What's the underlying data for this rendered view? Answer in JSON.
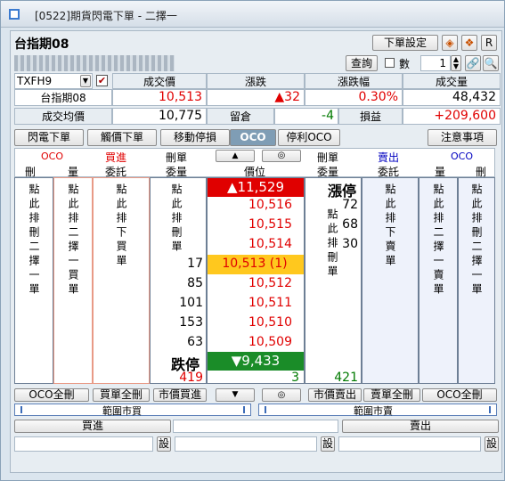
{
  "window": {
    "title": "[0522]期貨閃電下單 - 二擇一"
  },
  "header": {
    "name": "台指期08",
    "order_settings": "下單設定",
    "r_label": "R",
    "query": "查詢",
    "qty_label": "數",
    "qty_value": "1",
    "account_masked": "XXXXXXX XXXXXXXX"
  },
  "quote": {
    "symbol": "TXFH9",
    "labels": {
      "last": "成交價",
      "change": "漲跌",
      "pct": "漲跌幅",
      "volume": "成交量",
      "avg": "成交均價",
      "oi": "留倉",
      "pnl": "損益"
    },
    "product": "台指期08",
    "last": "10,513",
    "change": "▲32",
    "pct": "0.30%",
    "volume": "48,432",
    "avg": "10,775",
    "oi": "-4",
    "pnl": "+209,600"
  },
  "tabs": {
    "t1": "閃電下單",
    "t2": "觸價下單",
    "t3": "移動停損",
    "t4": "OCO",
    "t5": "停利OCO",
    "notes": "注意事項"
  },
  "columns": {
    "oco_l": "OCO",
    "buy": "買進",
    "mkt_l": "刪單",
    "up": "▲",
    "circle": "◎",
    "mkt_r": "刪單",
    "sell": "賣出",
    "oco_r": "OCO"
  },
  "subheads": {
    "s1": "刪",
    "s2": "量",
    "s3": "委託",
    "s4": "委量",
    "s5": "價位",
    "s6": "委量",
    "s7": "委託",
    "s8": "量",
    "s9": "刪"
  },
  "col_text": {
    "c1": "點此排刪二擇一單",
    "c2": "點此排二擇一買單",
    "c3": "點此排下買單",
    "c4": "點此排刪單",
    "c6": "點此排刪單",
    "c7": "點此排下賣單",
    "c8": "點此排二擇一賣單",
    "c9": "點此排刪二擇一單"
  },
  "ladder": {
    "limit_up": "漲停",
    "limit_up_price": "▲11,529",
    "prices": [
      "10,516",
      "10,515",
      "10,514",
      "10,513 (1)",
      "10,512",
      "10,511",
      "10,510",
      "10,509"
    ],
    "bid_vol": [
      "",
      "",
      "",
      "17",
      "85",
      "101",
      "153",
      "63"
    ],
    "ask_vol": [
      "72",
      "68",
      "30",
      "",
      "",
      "",
      "",
      ""
    ],
    "limit_down": "跌停",
    "limit_down_price": "▼9,433",
    "total_bid": "419",
    "mid_total": "3",
    "total_ask": "421"
  },
  "bottom": {
    "oco_all_l": "OCO全刪",
    "buy_all": "買單全刪",
    "mkt_buy": "市價買進",
    "down": "▼",
    "circle": "◎",
    "mkt_sell": "市價賣出",
    "sell_all": "賣單全刪",
    "oco_all_r": "OCO全刪",
    "range_buy": "範圍市買",
    "range_sell": "範圍市賣",
    "buy": "買進",
    "sell": "賣出",
    "set": "設"
  }
}
